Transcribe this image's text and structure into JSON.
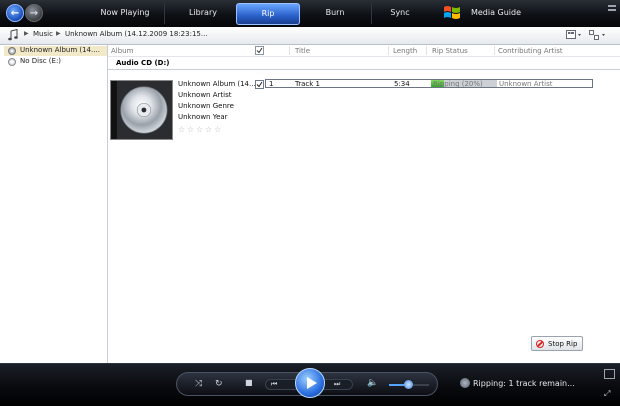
{
  "nav": {
    "tabs": [
      {
        "label": "Now Playing"
      },
      {
        "label": "Library"
      },
      {
        "label": "Rip"
      },
      {
        "label": "Burn"
      },
      {
        "label": "Sync"
      },
      {
        "label": "Media Guide"
      }
    ],
    "selected_tab": "Rip",
    "back_icon": "back-arrow-icon",
    "forward_icon": "forward-arrow-icon"
  },
  "breadcrumb": {
    "items": [
      "Music",
      "Unknown Album (14.12.2009 18:23:15..."
    ]
  },
  "sidebar": {
    "items": [
      {
        "label": "Unknown Album (14....",
        "icon": "cd-icon",
        "selected": true
      },
      {
        "label": "No Disc (E:)",
        "icon": "disc-icon",
        "selected": false
      }
    ]
  },
  "table": {
    "columns": [
      "Album",
      "Title",
      "Length",
      "Rip Status",
      "Contributing Artist"
    ],
    "group_header": "Audio CD (D:)",
    "album": {
      "name": "Unknown Album (14....",
      "artist": "Unknown Artist",
      "genre": "Unknown Genre",
      "year": "Unknown Year",
      "rating": 0
    },
    "rows": [
      {
        "checked": true,
        "number": "1",
        "title": "Track 1",
        "length": "5:34",
        "rip_status": "Ripping (20%)",
        "rip_progress": 0.2,
        "contributing_artist": "Unknown Artist"
      }
    ]
  },
  "stop_rip_label": "Stop Rip",
  "player": {
    "status_text": "Ripping: 1 track remain...",
    "volume_level": 0.45
  },
  "colors": {
    "accent": "#2a6ee0",
    "progress_fill": "#36a82a",
    "selection": "#f2e9c9"
  }
}
